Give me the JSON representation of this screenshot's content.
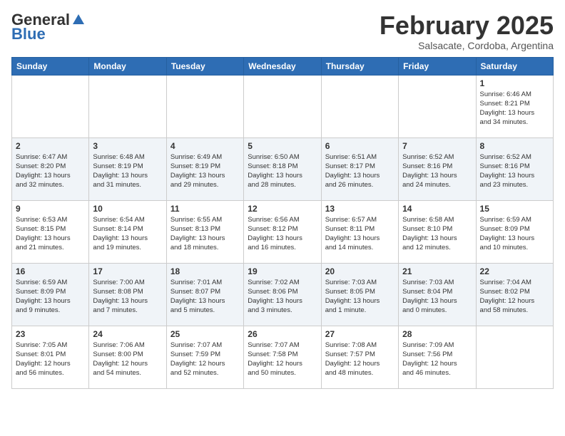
{
  "header": {
    "logo_general": "General",
    "logo_blue": "Blue",
    "month": "February 2025",
    "location": "Salsacate, Cordoba, Argentina"
  },
  "days_of_week": [
    "Sunday",
    "Monday",
    "Tuesday",
    "Wednesday",
    "Thursday",
    "Friday",
    "Saturday"
  ],
  "weeks": [
    [
      {
        "day": "",
        "info": ""
      },
      {
        "day": "",
        "info": ""
      },
      {
        "day": "",
        "info": ""
      },
      {
        "day": "",
        "info": ""
      },
      {
        "day": "",
        "info": ""
      },
      {
        "day": "",
        "info": ""
      },
      {
        "day": "1",
        "info": "Sunrise: 6:46 AM\nSunset: 8:21 PM\nDaylight: 13 hours\nand 34 minutes."
      }
    ],
    [
      {
        "day": "2",
        "info": "Sunrise: 6:47 AM\nSunset: 8:20 PM\nDaylight: 13 hours\nand 32 minutes."
      },
      {
        "day": "3",
        "info": "Sunrise: 6:48 AM\nSunset: 8:19 PM\nDaylight: 13 hours\nand 31 minutes."
      },
      {
        "day": "4",
        "info": "Sunrise: 6:49 AM\nSunset: 8:19 PM\nDaylight: 13 hours\nand 29 minutes."
      },
      {
        "day": "5",
        "info": "Sunrise: 6:50 AM\nSunset: 8:18 PM\nDaylight: 13 hours\nand 28 minutes."
      },
      {
        "day": "6",
        "info": "Sunrise: 6:51 AM\nSunset: 8:17 PM\nDaylight: 13 hours\nand 26 minutes."
      },
      {
        "day": "7",
        "info": "Sunrise: 6:52 AM\nSunset: 8:16 PM\nDaylight: 13 hours\nand 24 minutes."
      },
      {
        "day": "8",
        "info": "Sunrise: 6:52 AM\nSunset: 8:16 PM\nDaylight: 13 hours\nand 23 minutes."
      }
    ],
    [
      {
        "day": "9",
        "info": "Sunrise: 6:53 AM\nSunset: 8:15 PM\nDaylight: 13 hours\nand 21 minutes."
      },
      {
        "day": "10",
        "info": "Sunrise: 6:54 AM\nSunset: 8:14 PM\nDaylight: 13 hours\nand 19 minutes."
      },
      {
        "day": "11",
        "info": "Sunrise: 6:55 AM\nSunset: 8:13 PM\nDaylight: 13 hours\nand 18 minutes."
      },
      {
        "day": "12",
        "info": "Sunrise: 6:56 AM\nSunset: 8:12 PM\nDaylight: 13 hours\nand 16 minutes."
      },
      {
        "day": "13",
        "info": "Sunrise: 6:57 AM\nSunset: 8:11 PM\nDaylight: 13 hours\nand 14 minutes."
      },
      {
        "day": "14",
        "info": "Sunrise: 6:58 AM\nSunset: 8:10 PM\nDaylight: 13 hours\nand 12 minutes."
      },
      {
        "day": "15",
        "info": "Sunrise: 6:59 AM\nSunset: 8:09 PM\nDaylight: 13 hours\nand 10 minutes."
      }
    ],
    [
      {
        "day": "16",
        "info": "Sunrise: 6:59 AM\nSunset: 8:09 PM\nDaylight: 13 hours\nand 9 minutes."
      },
      {
        "day": "17",
        "info": "Sunrise: 7:00 AM\nSunset: 8:08 PM\nDaylight: 13 hours\nand 7 minutes."
      },
      {
        "day": "18",
        "info": "Sunrise: 7:01 AM\nSunset: 8:07 PM\nDaylight: 13 hours\nand 5 minutes."
      },
      {
        "day": "19",
        "info": "Sunrise: 7:02 AM\nSunset: 8:06 PM\nDaylight: 13 hours\nand 3 minutes."
      },
      {
        "day": "20",
        "info": "Sunrise: 7:03 AM\nSunset: 8:05 PM\nDaylight: 13 hours\nand 1 minute."
      },
      {
        "day": "21",
        "info": "Sunrise: 7:03 AM\nSunset: 8:04 PM\nDaylight: 13 hours\nand 0 minutes."
      },
      {
        "day": "22",
        "info": "Sunrise: 7:04 AM\nSunset: 8:02 PM\nDaylight: 12 hours\nand 58 minutes."
      }
    ],
    [
      {
        "day": "23",
        "info": "Sunrise: 7:05 AM\nSunset: 8:01 PM\nDaylight: 12 hours\nand 56 minutes."
      },
      {
        "day": "24",
        "info": "Sunrise: 7:06 AM\nSunset: 8:00 PM\nDaylight: 12 hours\nand 54 minutes."
      },
      {
        "day": "25",
        "info": "Sunrise: 7:07 AM\nSunset: 7:59 PM\nDaylight: 12 hours\nand 52 minutes."
      },
      {
        "day": "26",
        "info": "Sunrise: 7:07 AM\nSunset: 7:58 PM\nDaylight: 12 hours\nand 50 minutes."
      },
      {
        "day": "27",
        "info": "Sunrise: 7:08 AM\nSunset: 7:57 PM\nDaylight: 12 hours\nand 48 minutes."
      },
      {
        "day": "28",
        "info": "Sunrise: 7:09 AM\nSunset: 7:56 PM\nDaylight: 12 hours\nand 46 minutes."
      },
      {
        "day": "",
        "info": ""
      }
    ]
  ]
}
